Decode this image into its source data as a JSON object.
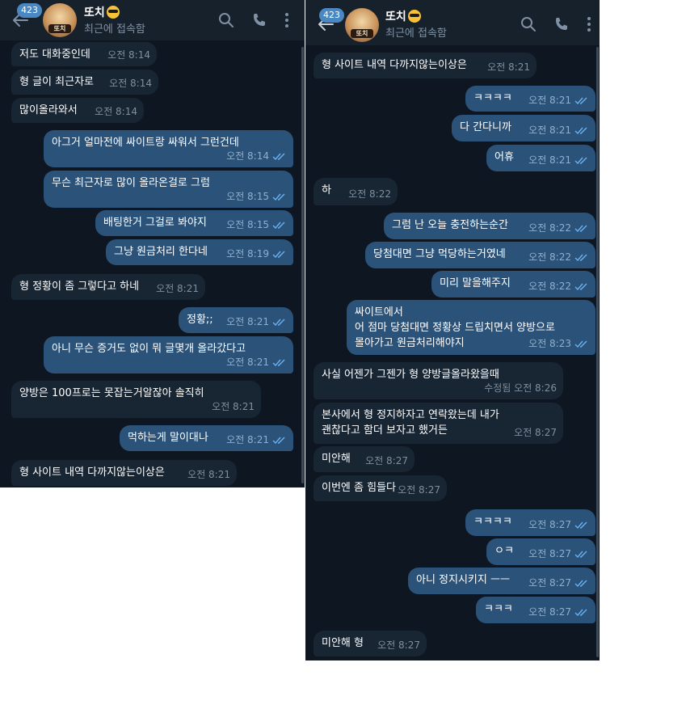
{
  "chat": {
    "contact_name": "또치",
    "status": "최근에 접속함",
    "unread_count": "423",
    "avatar_label": "또치"
  },
  "left_messages": [
    {
      "text": "저도 대화중인데",
      "time": "오전 8:14",
      "dir": "in"
    },
    {
      "text": "형 글이 최근자로",
      "time": "오전 8:14",
      "dir": "in"
    },
    {
      "text": "많이올라와서",
      "time": "오전 8:14",
      "dir": "in"
    },
    {
      "text": "아그거 얼마전에 싸이트랑 싸워서 그런건데",
      "time": "오전 8:14",
      "dir": "out"
    },
    {
      "text": "무슨 최근자로 많이 올라온걸로 그럼",
      "time": "오전 8:15",
      "dir": "out"
    },
    {
      "text": "배팅한거 그걸로 봐야지",
      "time": "오전 8:15",
      "dir": "out"
    },
    {
      "text": "그냥 원금처리 한다네",
      "time": "오전 8:19",
      "dir": "out"
    },
    {
      "text": "형 정황이 좀 그렇다고 하네",
      "time": "오전 8:21",
      "dir": "in"
    },
    {
      "text": "정황;;",
      "time": "오전 8:21",
      "dir": "out"
    },
    {
      "text": "아니 무슨 증거도 없이 뭐 글몇개 올라갔다고",
      "time": "오전 8:21",
      "dir": "out"
    },
    {
      "text": "양방은 100프로는 못잡는거알잖아 솔직히",
      "time": "오전 8:21",
      "dir": "in"
    },
    {
      "text": "먹하는게 말이대나",
      "time": "오전 8:21",
      "dir": "out"
    },
    {
      "text": "형 사이트 내역 다까지않는이상은",
      "time": "오전 8:21",
      "dir": "in"
    }
  ],
  "right_messages": [
    {
      "text": "형 사이트 내역 다까지않는이상은",
      "time": "오전 8:21",
      "dir": "in"
    },
    {
      "text": "ㅋㅋㅋㅋ",
      "time": "오전 8:21",
      "dir": "out"
    },
    {
      "text": "다 간다니까",
      "time": "오전 8:21",
      "dir": "out"
    },
    {
      "text": "어휴",
      "time": "오전 8:21",
      "dir": "out"
    },
    {
      "text": "하",
      "time": "오전 8:22",
      "dir": "in"
    },
    {
      "text": "그럼 난 오늘 충전하는순간",
      "time": "오전 8:22",
      "dir": "out"
    },
    {
      "text": "당첨대면 그냥 먹당하는거였네",
      "time": "오전 8:22",
      "dir": "out"
    },
    {
      "text": "미리 말을해주지",
      "time": "오전 8:22",
      "dir": "out"
    },
    {
      "text": "싸이트에서\n어 점마 당첨대면 정황상 드립치면서 양방으로\n몰아가고 원금처리해야지",
      "time": "오전 8:23",
      "dir": "out"
    },
    {
      "text": "사실 어젠가 그젠가 형 양방글올라왔을때",
      "time": "수정됨 오전 8:26",
      "dir": "in"
    },
    {
      "text": "본사에서 형 정지하자고 연락왔는데 내가\n괜찮다고 함더 보자고 했거든",
      "time": "오전 8:27",
      "dir": "in"
    },
    {
      "text": "미안해",
      "time": "오전 8:27",
      "dir": "in"
    },
    {
      "text": "이번엔 좀 힘들다",
      "time": "오전 8:27",
      "dir": "in"
    },
    {
      "text": "ㅋㅋㅋㅋ",
      "time": "오전 8:27",
      "dir": "out"
    },
    {
      "text": "ㅇㅋ",
      "time": "오전 8:27",
      "dir": "out"
    },
    {
      "text": "아니 정지시키지 ㅡㅡ",
      "time": "오전 8:27",
      "dir": "out"
    },
    {
      "text": "ㅋㅋㅋ",
      "time": "오전 8:27",
      "dir": "out"
    },
    {
      "text": "미안해 형",
      "time": "오전 8:27",
      "dir": "in"
    }
  ],
  "colors": {
    "background": "#0e1621",
    "header": "#17212b",
    "incoming_bubble": "#182533",
    "outgoing_bubble": "#2b5278",
    "badge": "#4a88c4",
    "check": "#6ab2f2"
  }
}
